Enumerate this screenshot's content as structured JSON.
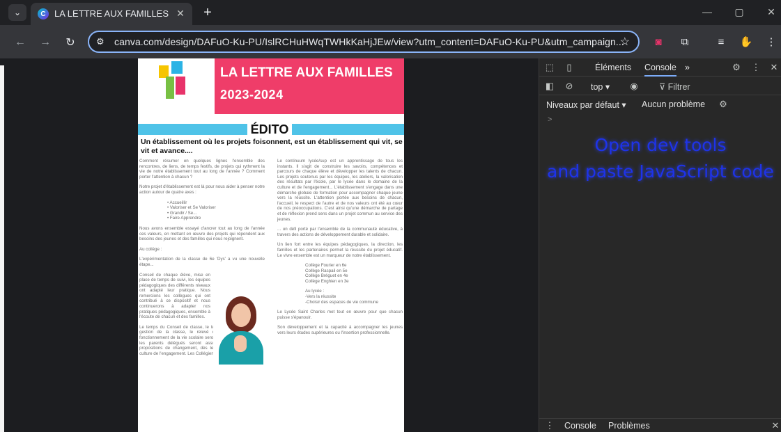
{
  "browser": {
    "tab_title": "LA LETTRE AUX FAMILLES",
    "tab_menu_icon": "chevron-down-icon",
    "new_tab_symbol": "+",
    "url": "canva.com/design/DAFuO-Ku-PU/IslRCHuHWqTWHkKaHjJEw/view?utm_content=DAFuO-Ku-PU&utm_campaign...",
    "window_controls": [
      "—",
      "▢",
      "✕"
    ]
  },
  "document": {
    "banner_title": "LA LETTRE AUX FAMILLES",
    "banner_year": "2023-2024",
    "section_label": "ÉDITO",
    "subtitle": "Un établissement où les projets foisonnent, est  un établissement qui vit, se vit et avance....",
    "left_col": {
      "p1": "Comment résumer en quelques lignes l'ensemble des rencontres, de liens, de temps festifs, de projets qui rythment la vie de notre établissement tout au long de l'année ? Comment porter l'attention à chacun ?",
      "p2": "Notre projet d'établissement est là pour nous aider à penser notre action autour de quatre axes :",
      "bullets": [
        "• Accueillir",
        "• Valoriser et Se Valoriser",
        "• Grandir / Se...",
        "• Faire Apprendre"
      ],
      "p3": "Nous avons ensemble essayé d'ancrer tout au long de l'année ces valeurs, en mettant en œuvre des projets qui répondent aux besoins des jeunes et des familles qui nous rejoignent.",
      "college": "Au collège :",
      "p4": "L'expérimentation de la classe de 6e 'Dys' a vu une nouvelle étape...",
      "p5": "Conseil de chaque élève, mise en place de temps de suivi, les équipes pédagogiques des différents niveaux ont adapté leur pratique. Nous remercions les collègues qui ont contribué à ce dispositif et nous continuerons à adapter nos pratiques pédagogiques, ensemble à l'écoute de chacun et des familles.",
      "p6": "Le temps du Conseil de classe, le temps de participation à la gestion de la classe, le relevé des points à retenir, le fonctionnement de la vie scolaire seront observés. Les élèves et les parents délégués seront associés à des temps de propositions de changement, dès le printemps, autour de la culture de l'engagement. Les Collégiens dans leur parcours."
    },
    "right_col": {
      "p1": "Le continuum lycée/sup est un apprentissage de tous les instants. Il s'agit de construire les savoirs, compétences et parcours de chaque élève et développer les talents de chacun. Les projets soutenus par les équipes, les ateliers, la valorisation des résultats par l'école, par le lycée dans le domaine de la culture et de l'engagement... L'établissement s'engage dans une démarche globale de formation pour accompagner chaque jeune vers la réussite. L'attention portée aux besoins de chacun, l'accueil, le respect de l'autre et de nos valeurs ont été au cœur de nos préoccupations. C'est ainsi qu'une démarche de partage et de réflexion prend sens dans un projet commun au service des jeunes.",
      "p2": "... un défi porté par l'ensemble de la communauté éducative, à travers des actions de développement durable et solidaire.",
      "p3": "Un lien fort entre les équipes pédagogiques, la direction, les familles et les partenaires permet la réussite du projet éducatif. Le vivre ensemble est un marqueur de notre établissement.",
      "list": [
        "Collège Fourier en 6e",
        "Collège Raspail en 5e",
        "Collège Bréguet en 4e",
        "Collège Enghien en 3e"
      ],
      "lycee": "Au lycée :",
      "lycee_items": [
        "-Vers la réussite",
        "-Choisir des espaces de vie commune"
      ],
      "p4": "Le Lycée Saint Charles met tout en œuvre pour que chacun puisse s'épanouir.",
      "p5": "Son développement et la capacité à accompagner les jeunes vers leurs études supérieures ou l'insertion professionnelle."
    }
  },
  "devtools": {
    "tabs": [
      "Éléments",
      "Console"
    ],
    "more_tabs": "»",
    "context": "top",
    "filter_placeholder": "Filtrer",
    "levels": "Niveaux par défaut",
    "issues": "Aucun problème",
    "prompt": ">",
    "overlay_line1": "Open dev tools",
    "overlay_line2": "and paste JavaScript code",
    "bottom_tabs": [
      "Console",
      "Problèmes"
    ]
  },
  "colors": {
    "banner": "#ef3d69",
    "edito_bar": "#4fc3e8",
    "overlay_text": "#1d35ff",
    "omnibox_border": "#8ab4f8"
  }
}
